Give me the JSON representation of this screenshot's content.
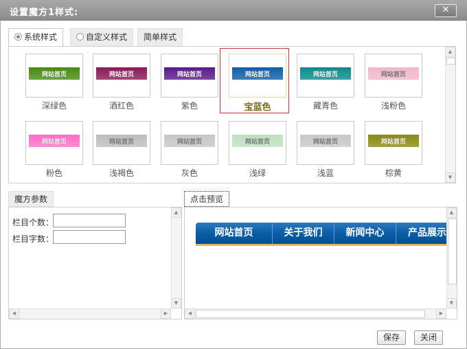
{
  "dialog": {
    "title": "设置魔方1样式:",
    "close_icon": "close-icon"
  },
  "tabs": [
    {
      "label": "系统样式",
      "radio": true,
      "active": true
    },
    {
      "label": "自定义样式",
      "radio": true,
      "active": false
    },
    {
      "label": "简单样式",
      "radio": false,
      "active": false
    }
  ],
  "thumb_text": "网站首页",
  "styles": [
    {
      "label": "深绿色",
      "color": "#4a8a12",
      "light": false
    },
    {
      "label": "酒红色",
      "color": "#8a1a5a",
      "light": false
    },
    {
      "label": "紫色",
      "color": "#5a1a8a",
      "light": false
    },
    {
      "label": "宝蓝色",
      "color": "#0f5fa5",
      "light": false,
      "selected": true
    },
    {
      "label": "藏青色",
      "color": "#0a8a8a",
      "light": false
    },
    {
      "label": "浅粉色",
      "color": "#f0b8c8",
      "light": true
    },
    {
      "label": "粉色",
      "color": "#ff6ec8",
      "light": false
    },
    {
      "label": "浅褐色",
      "color": "#bdbdbd",
      "light": true
    },
    {
      "label": "灰色",
      "color": "#c6c6c6",
      "light": true
    },
    {
      "label": "浅绿",
      "color": "#bfe0bf",
      "light": true
    },
    {
      "label": "浅蓝",
      "color": "#c8c8c8",
      "light": true
    },
    {
      "label": "棕黄",
      "color": "#8a8a12",
      "light": false
    }
  ],
  "params": {
    "tab_label": "魔方参数",
    "column_count_label": "栏目个数：",
    "column_chars_label": "栏目字数："
  },
  "preview": {
    "tab_label": "点击预览",
    "nav_items": [
      "网站首页",
      "关于我们",
      "新闻中心",
      "产品展示"
    ]
  },
  "buttons": {
    "save": "保存",
    "close": "关闭"
  }
}
